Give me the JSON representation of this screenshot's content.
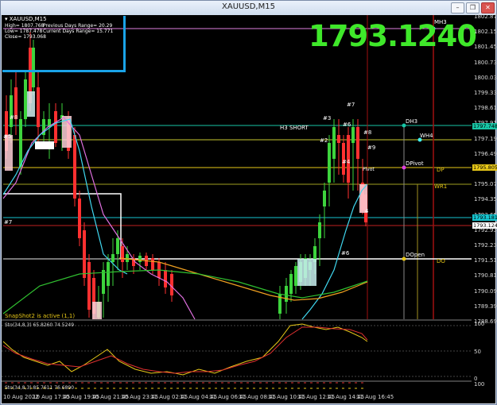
{
  "window": {
    "title": "XAUUSD,M15",
    "controls": [
      "minimize",
      "restore",
      "close"
    ]
  },
  "symbol_label": "XAUUSD,M15",
  "big_price": "1793.1240",
  "info": {
    "high": "High= 1807.768",
    "low": "Low= 1787.478",
    "close": "Close= 1793.068",
    "prev_range": "Previous Days Range= 20.29",
    "curr_range": "Current Days Range= 15.771"
  },
  "price_scale": [
    "1802.876",
    "1802.156",
    "1801.456",
    "1800.736",
    "1800.036",
    "1799.336",
    "1798.616",
    "1797.916",
    "1797.196",
    "1796.496",
    "1795.776",
    "1795.076",
    "1794.356",
    "1793.656",
    "1792.936",
    "1792.236",
    "1791.516",
    "1790.816",
    "1790.096",
    "1789.396",
    "1788.696"
  ],
  "price_tags": [
    {
      "text": "1797.748",
      "color": "#17c6a6"
    },
    {
      "text": "1795.805",
      "color": "#e8c818"
    },
    {
      "text": "1793.181",
      "color": "#16c5d0"
    },
    {
      "text": "1793.124",
      "color": "#ffffff"
    }
  ],
  "levels": {
    "mh3": "MH3",
    "dh3": "DH3",
    "wh4": "WH4",
    "dpivot": "DPivot",
    "dp": "DP",
    "wr1": "WR1",
    "dopen": "DOpen",
    "do": "DO",
    "h3short": "H3 SHORT",
    "pivot": "Pivot"
  },
  "markers": [
    "#8",
    "#5",
    "#7",
    "#3",
    "#7",
    "#6",
    "#2",
    "#4",
    "#8",
    "#9",
    "#6",
    "4"
  ],
  "snapshot_text": "SnapShot2 is active (1,1)",
  "stoch1": {
    "label": "Sto(34,8,3) 65.8260 74.5249",
    "scale": [
      "100",
      "50",
      "0"
    ]
  },
  "stoch2": {
    "label": "Sto(34,8,3) 85.7611 76.6890",
    "scale": [
      "100",
      "0"
    ]
  },
  "time_axis": [
    "10 Aug 2022",
    "10 Aug 17:45",
    "10 Aug 19:45",
    "10 Aug 21:45",
    "10 Aug 23:45",
    "11 Aug 02:45",
    "11 Aug 04:45",
    "11 Aug 06:45",
    "11 Aug 08:45",
    "11 Aug 10:45",
    "11 Aug 12:45",
    "11 Aug 14:45",
    "11 Aug 16:45"
  ],
  "colors": {
    "bull": "#3dd43d",
    "bear": "#ff3030",
    "pivot_line": "#ffffff",
    "ma_cyan": "#40d8f0",
    "ma_pink": "#e070e0",
    "ma_orange": "#f0a020",
    "ma_green": "#30c030"
  }
}
